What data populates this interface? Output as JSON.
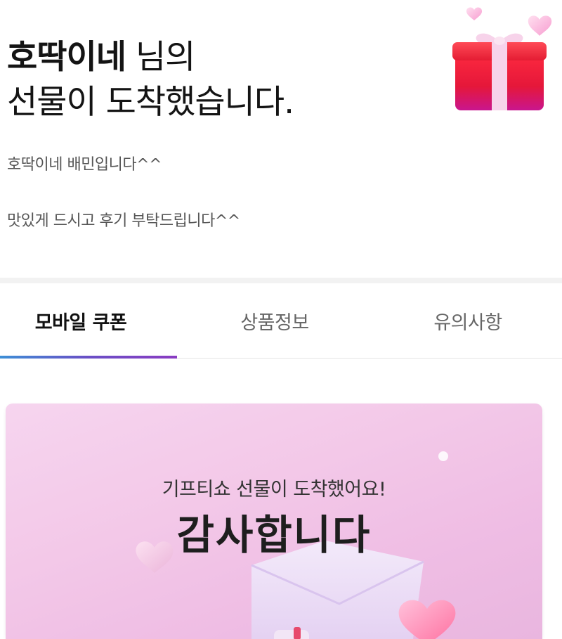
{
  "header": {
    "sender": "호딱이네",
    "title_suffix": " 님의",
    "title_line2": "선물이 도착했습니다.",
    "message_line1": "호딱이네 배민입니다^^",
    "message_line2": "맛있게 드시고 후기 부탁드립니다^^"
  },
  "tabs": [
    {
      "label": "모바일 쿠폰",
      "active": true
    },
    {
      "label": "상품정보",
      "active": false
    },
    {
      "label": "유의사항",
      "active": false
    }
  ],
  "coupon": {
    "subtitle": "기프티쇼 선물이 도착했어요!",
    "headline": "감사합니다"
  },
  "colors": {
    "tab_indicator_start": "#3d8fd6",
    "tab_indicator_end": "#8a3cc2",
    "coupon_bg": "#f3c8e8",
    "gift_box": "#e8203a"
  }
}
